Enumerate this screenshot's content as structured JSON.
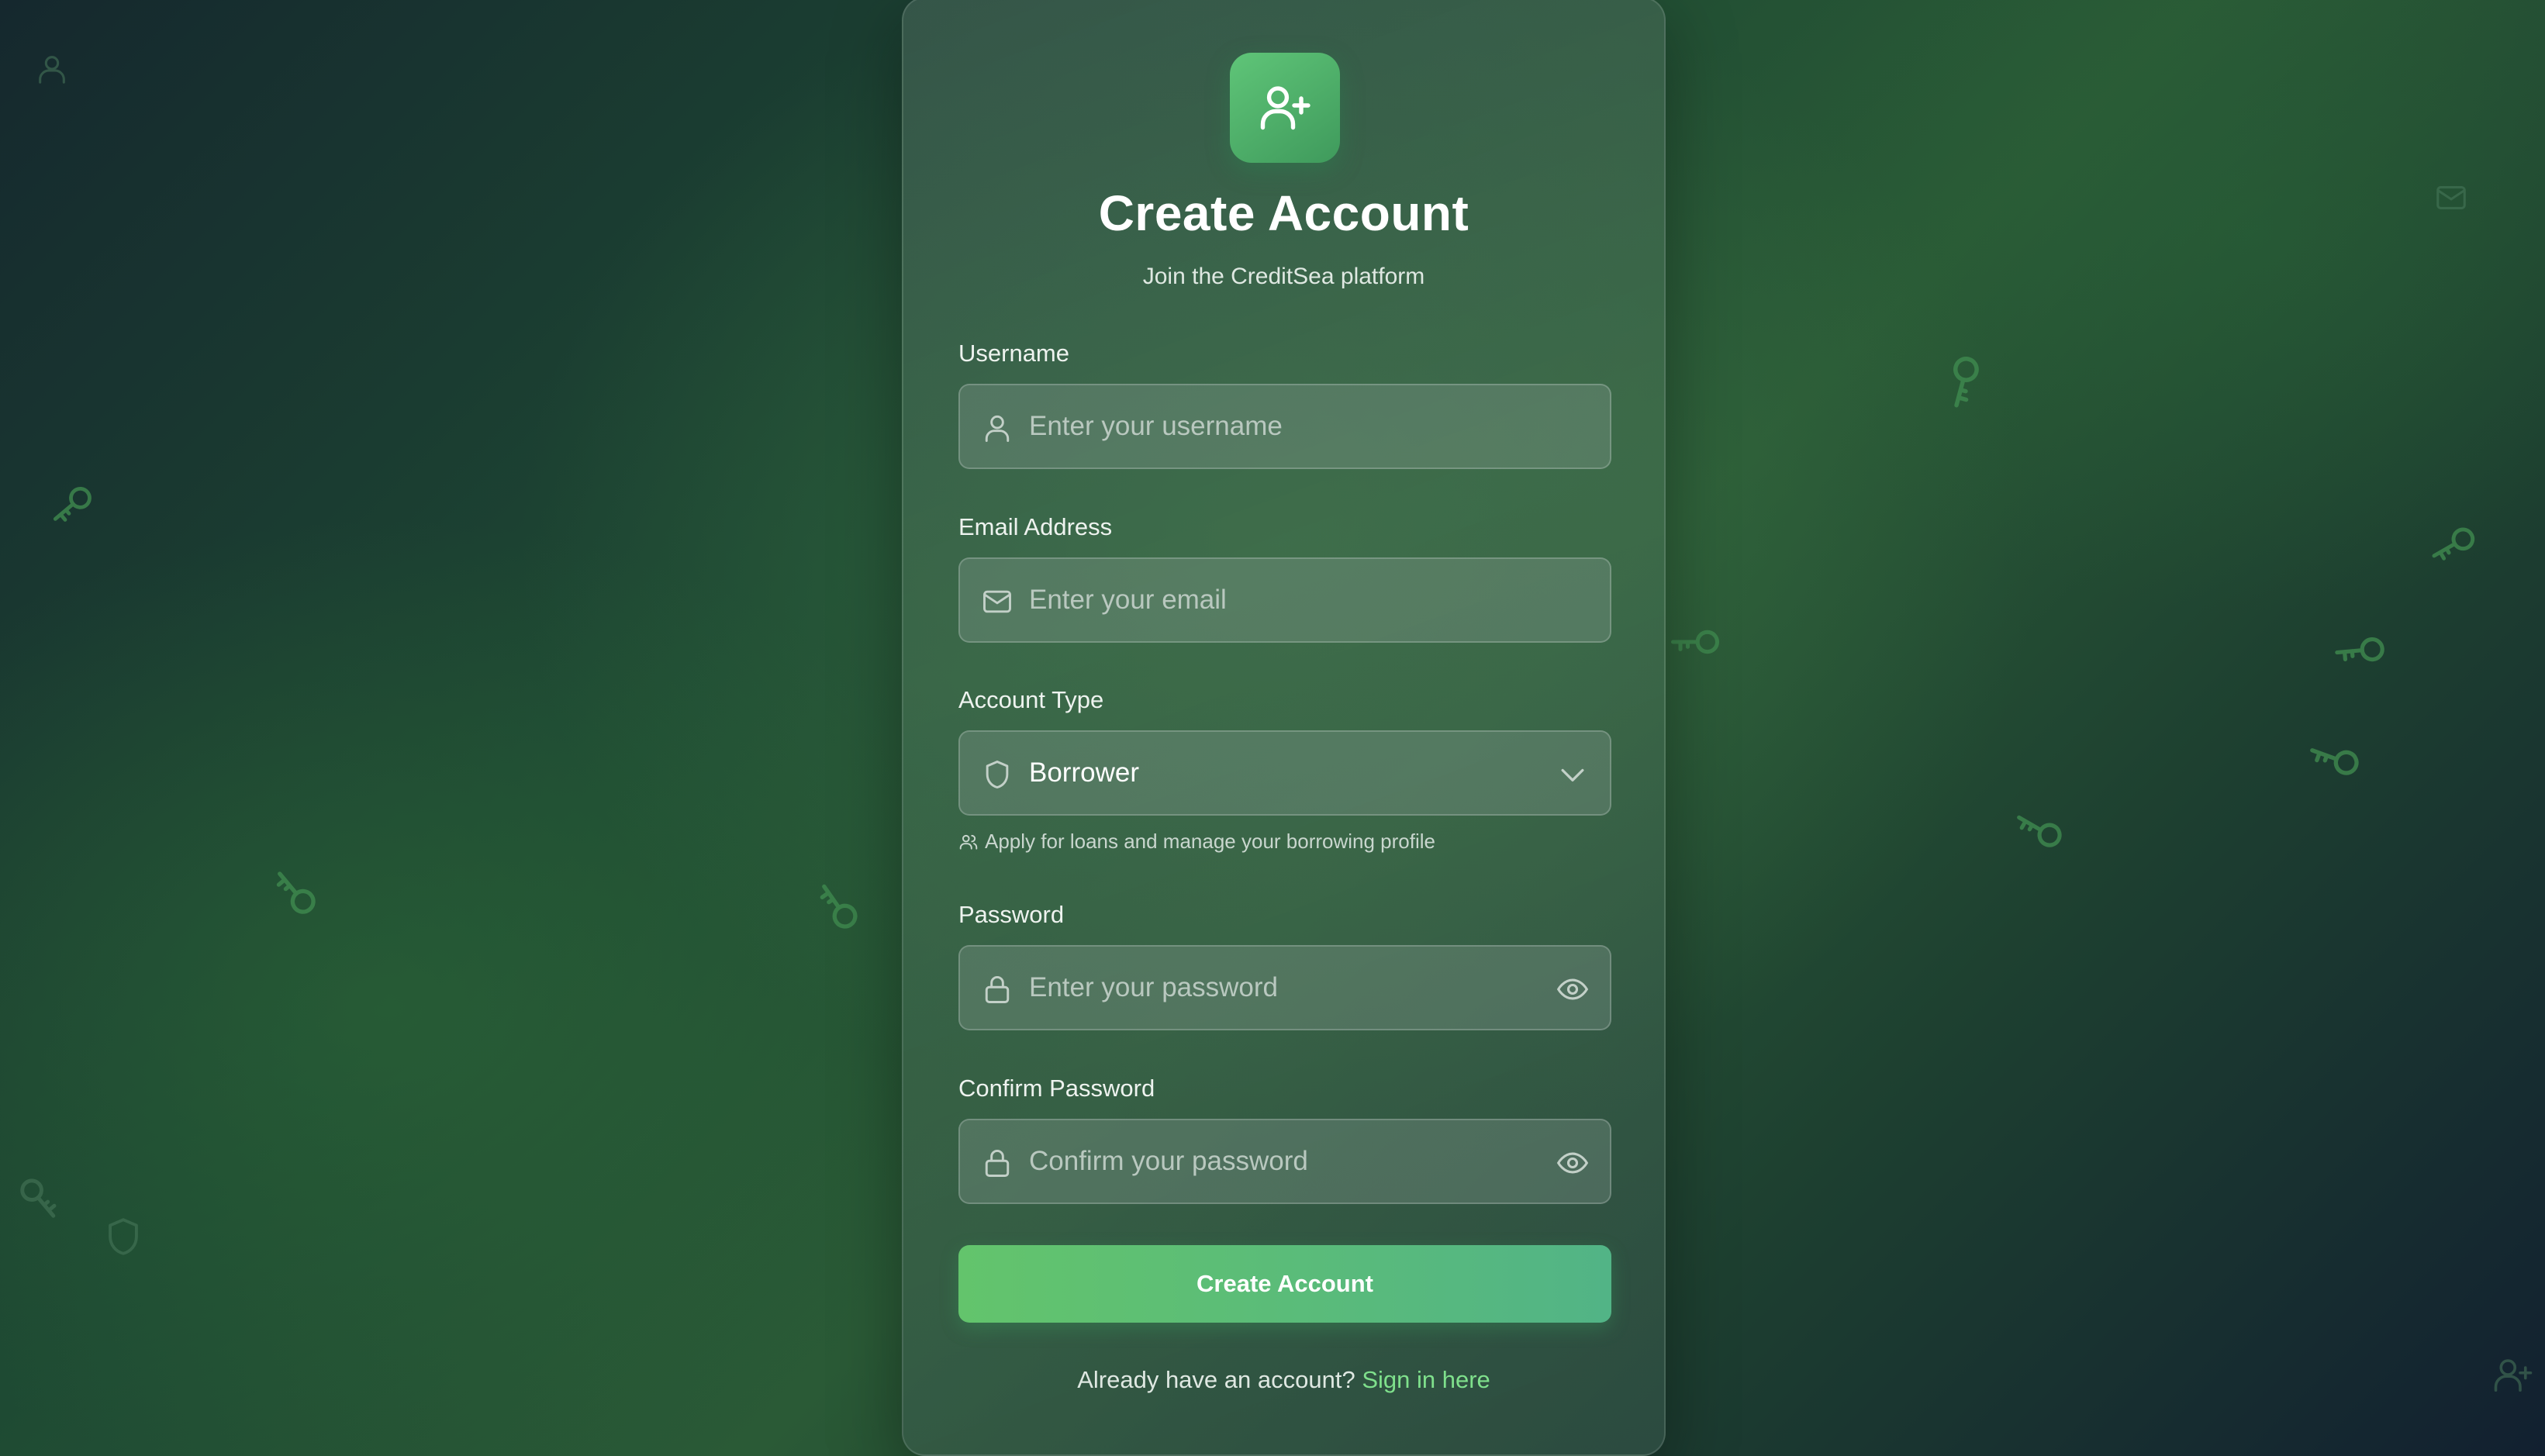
{
  "header": {
    "title": "Create Account",
    "subtitle": "Join the CreditSea platform",
    "logo_icon": "user-plus-icon"
  },
  "form": {
    "username": {
      "label": "Username",
      "placeholder": "Enter your username",
      "icon": "user-icon"
    },
    "email": {
      "label": "Email Address",
      "placeholder": "Enter your email",
      "icon": "mail-icon"
    },
    "account_type": {
      "label": "Account Type",
      "value": "Borrower",
      "icon": "shield-icon",
      "hint": "Apply for loans and manage your borrowing profile"
    },
    "password": {
      "label": "Password",
      "placeholder": "Enter your password",
      "icon": "lock-icon"
    },
    "confirm_password": {
      "label": "Confirm Password",
      "placeholder": "Confirm your password",
      "icon": "lock-icon"
    },
    "submit_label": "Create Account"
  },
  "footer": {
    "prompt": "Already have an account?",
    "link": "Sign in here"
  },
  "colors": {
    "accent": "#5fc578",
    "link": "#7fe08c",
    "background": "#1e4a33"
  }
}
